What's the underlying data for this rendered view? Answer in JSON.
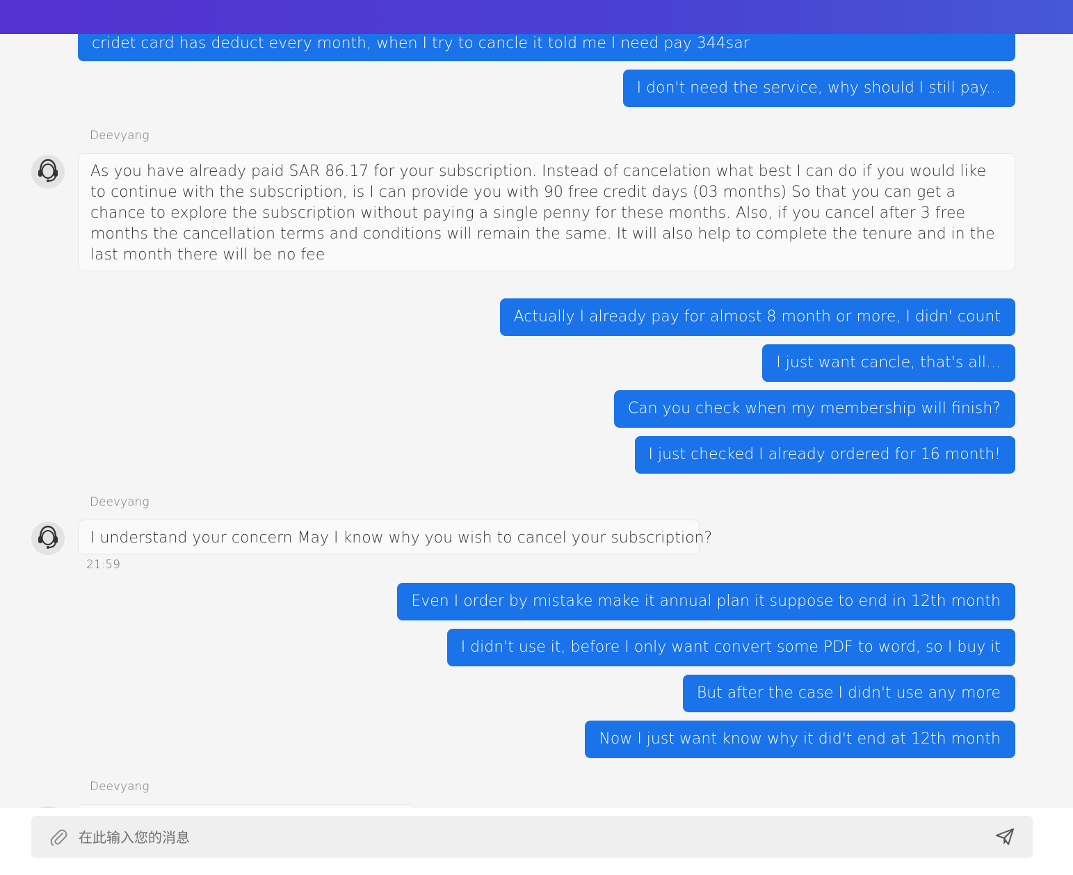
{
  "chat": {
    "top_partial_message": "cridet card has deduct every month, when I try to cancle it told me I need pay 344sar",
    "messages_group1": [
      "I don't need the service, why should I still pay..."
    ],
    "agent1": {
      "name": "Deevyang",
      "text": "As you have already paid SAR 86.17 for your subscription. Instead of cancelation what best I can do if you would like to continue with the subscription, is I can provide you with 90 free credit days (03 months) So that you can get a chance to explore the subscription without paying a single penny for these months. Also, if you cancel after 3 free months the cancellation terms and conditions will remain the same. It will also help to complete the tenure and in the last month there will be no fee"
    },
    "messages_group2": [
      "Actually I already pay for almost 8 month or more, I didn' count",
      "I just want cancle, that's all...",
      "Can you check when my membership will finish?",
      "I just checked I already ordered for 16 month!"
    ],
    "agent2": {
      "name": "Deevyang",
      "text": "I understand your concern May I know why you wish to cancel your subscription?",
      "time": "21:59"
    },
    "messages_group3": [
      "Even I order by mistake make it annual plan it suppose to end in 12th month",
      "I didn't use it, before I only want convert some PDF to word, so I buy it",
      "But after the case I didn't use any more",
      "Now I just want know why it did't end at 12th month"
    ],
    "agent3": {
      "name": "Deevyang"
    }
  },
  "composer": {
    "placeholder": "在此输入您的消息",
    "value": ""
  },
  "icons": {
    "avatar": "headset-agent-icon",
    "attach": "paperclip-icon",
    "send": "send-icon"
  },
  "colors": {
    "header_gradient_start": "#5433d0",
    "header_gradient_end": "#4658d6",
    "user_bubble": "#1a73e8",
    "background": "#f5f5f5"
  }
}
